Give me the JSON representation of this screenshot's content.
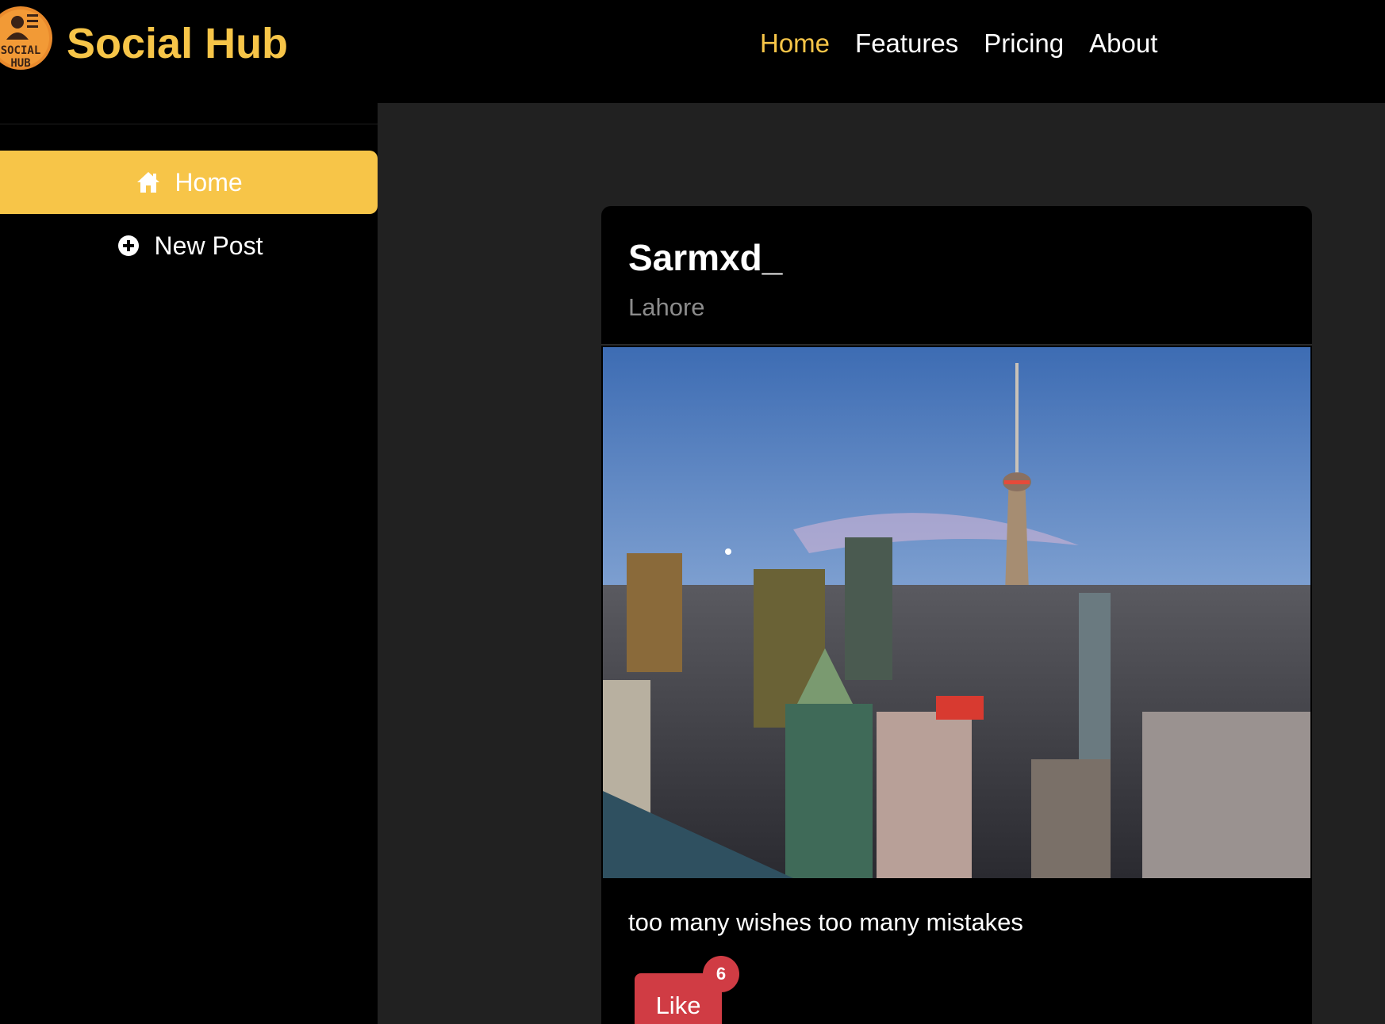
{
  "brand": {
    "name": "Social Hub",
    "logo_text_line1": "SOCIAL",
    "logo_text_line2": "HUB",
    "accent_color": "#f7c548"
  },
  "nav": {
    "items": [
      {
        "label": "Home",
        "active": true
      },
      {
        "label": "Features",
        "active": false
      },
      {
        "label": "Pricing",
        "active": false
      },
      {
        "label": "About",
        "active": false
      }
    ]
  },
  "sidebar": {
    "items": [
      {
        "label": "Home",
        "icon": "home-icon",
        "active": true
      },
      {
        "label": "New Post",
        "icon": "plus-circle-icon",
        "active": false
      }
    ]
  },
  "post": {
    "username": "Sarmxd_",
    "location": "Lahore",
    "image_alt": "city-skyline-photo",
    "caption": "too many wishes too many mistakes",
    "like_label": "Like",
    "like_count": "6",
    "like_color": "#d03c44"
  }
}
